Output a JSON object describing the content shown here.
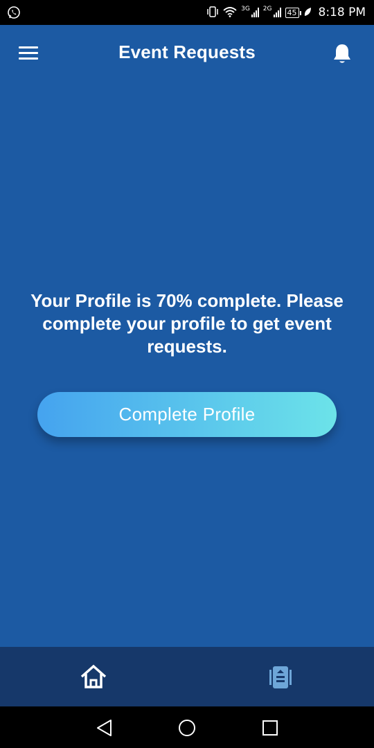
{
  "status_bar": {
    "left_icon": "whatsapp-icon",
    "network_1": "3G",
    "network_2": "2G",
    "battery": "45",
    "time": "8:18 PM"
  },
  "header": {
    "title": "Event Requests",
    "menu_icon": "hamburger-menu-icon",
    "notification_icon": "bell-icon"
  },
  "main": {
    "message": "Your Profile is 70% complete. Please complete your profile to get event requests.",
    "complete_button_label": "Complete Profile"
  },
  "bottom_nav": {
    "items": [
      {
        "icon": "home-icon"
      },
      {
        "icon": "requests-icon"
      }
    ]
  },
  "android_nav": {
    "keys": [
      "back-icon",
      "home-circle-icon",
      "recents-icon"
    ]
  },
  "colors": {
    "background": "#1c5aa3",
    "bottom_nav": "#16386a",
    "button_gradient_start": "#45a3ef",
    "button_gradient_end": "#6ce3e9",
    "requests_icon": "#6ea6d8"
  }
}
